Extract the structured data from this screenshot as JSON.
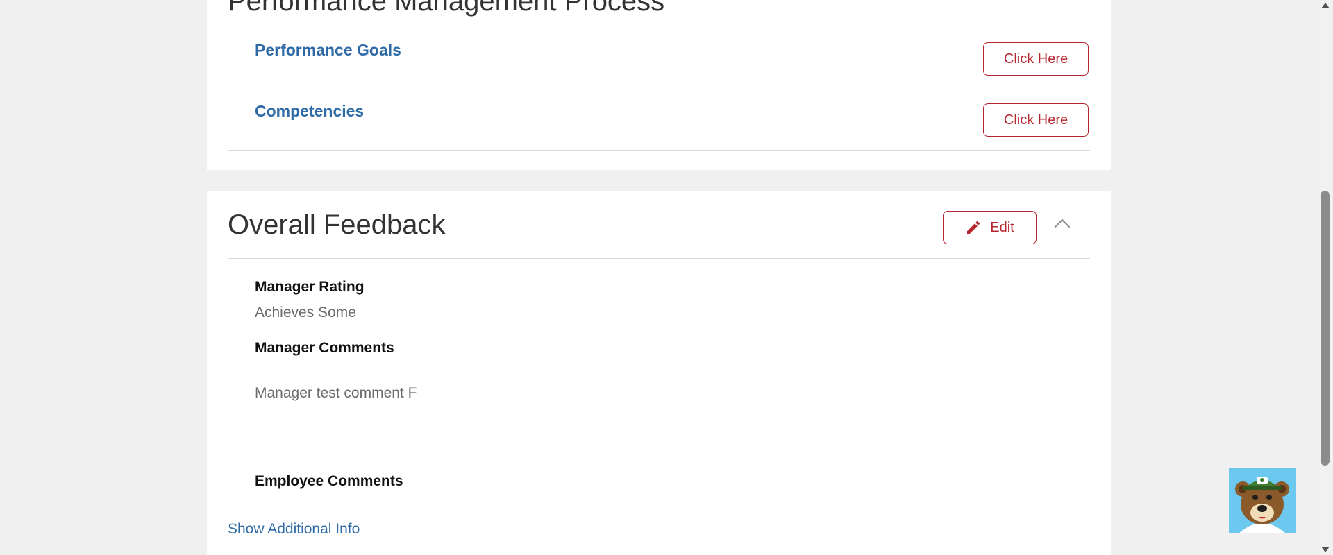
{
  "performance_section": {
    "title": "Performance Management Process",
    "items": [
      {
        "label": "Performance Goals",
        "button": "Click Here"
      },
      {
        "label": "Competencies",
        "button": "Click Here"
      }
    ]
  },
  "feedback_section": {
    "title": "Overall Feedback",
    "edit_label": "Edit",
    "fields": [
      {
        "label": "Manager Rating",
        "value": "Achieves Some"
      },
      {
        "label": "Manager Comments",
        "value": "Manager test comment F"
      },
      {
        "label": "Employee Comments",
        "value": ""
      }
    ],
    "show_more": "Show Additional Info"
  },
  "colors": {
    "accent_red": "#b5262e",
    "link_blue": "#2e6ba6",
    "background": "#f0f0f0"
  },
  "icons": {
    "edit": "pencil-icon",
    "collapse": "chevron-up-icon",
    "assistant": "bear-mascot-icon"
  }
}
